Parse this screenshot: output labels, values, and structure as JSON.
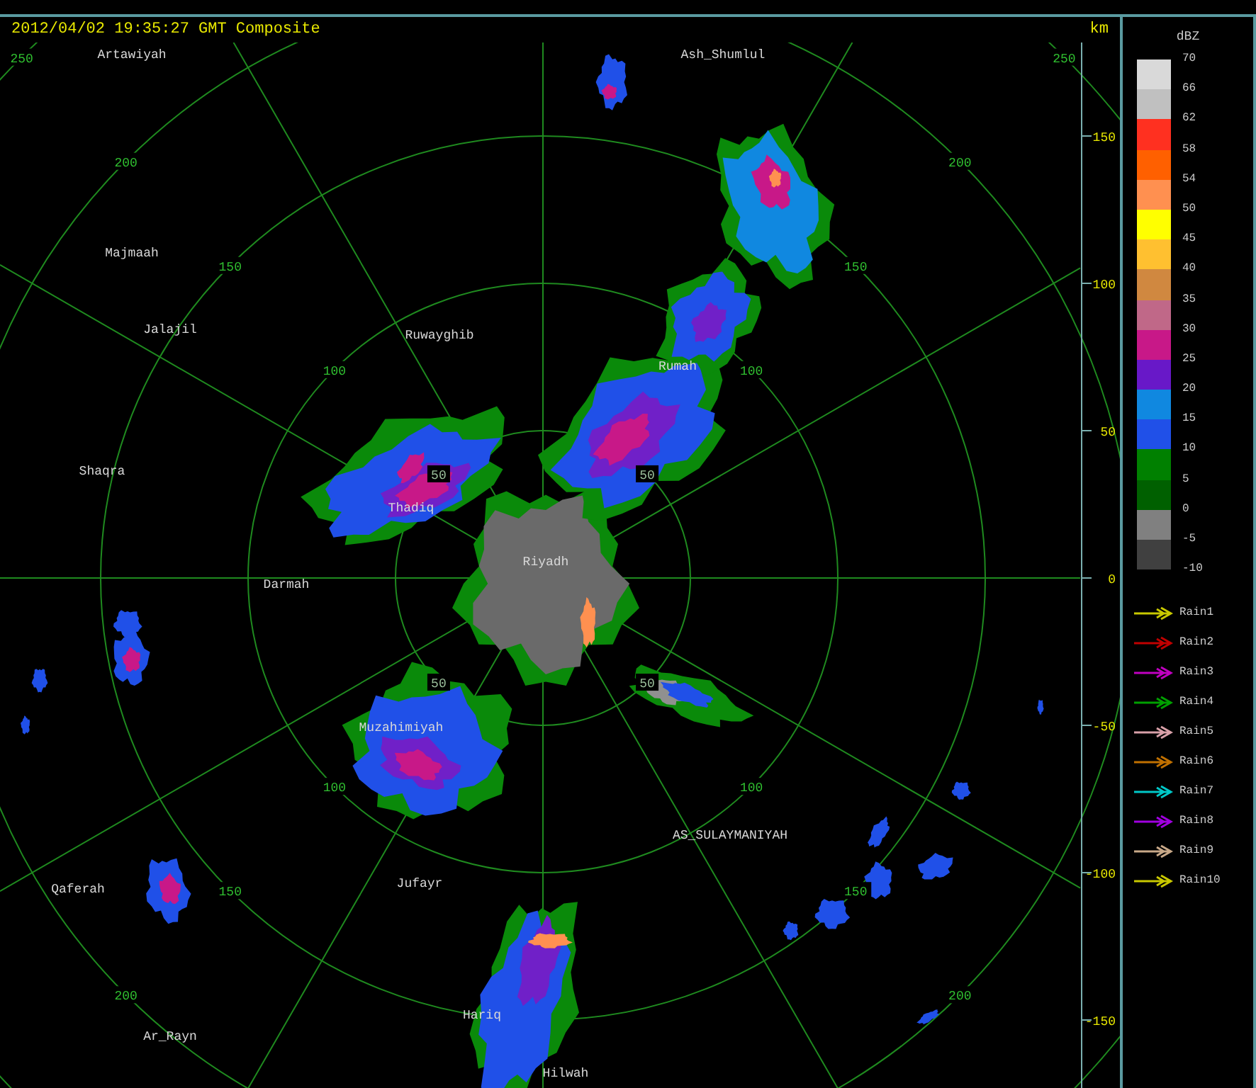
{
  "header": {
    "title": "2012/04/02 19:35:27 GMT Composite",
    "unit": "km"
  },
  "legend": {
    "unit": "dBZ",
    "levels": [
      {
        "label": "70",
        "color": "#d9d9d9"
      },
      {
        "label": "66",
        "color": "#c0c0c0"
      },
      {
        "label": "62",
        "color": "#ff3020"
      },
      {
        "label": "58",
        "color": "#ff6000"
      },
      {
        "label": "54",
        "color": "#ff9050"
      },
      {
        "label": "50",
        "color": "#ffff00"
      },
      {
        "label": "45",
        "color": "#ffc030"
      },
      {
        "label": "40",
        "color": "#d08840"
      },
      {
        "label": "35",
        "color": "#c06888"
      },
      {
        "label": "30",
        "color": "#c81888"
      },
      {
        "label": "25",
        "color": "#6818c8"
      },
      {
        "label": "20",
        "color": "#1088e0"
      },
      {
        "label": "15",
        "color": "#2050e8"
      },
      {
        "label": "10",
        "color": "#008000"
      },
      {
        "label": "5",
        "color": "#006000"
      },
      {
        "label": "0",
        "color": "#808080"
      },
      {
        "label": "-5",
        "color": "#404040"
      },
      {
        "label": "-10"
      }
    ]
  },
  "rain_legend": [
    {
      "label": "Rain1",
      "color": "#c8c800"
    },
    {
      "label": "Rain2",
      "color": "#c00000"
    },
    {
      "label": "Rain3",
      "color": "#c000c0"
    },
    {
      "label": "Rain4",
      "color": "#00a000"
    },
    {
      "label": "Rain5",
      "color": "#d8a0a8"
    },
    {
      "label": "Rain6",
      "color": "#c07000"
    },
    {
      "label": "Rain7",
      "color": "#00c8c8"
    },
    {
      "label": "Rain8",
      "color": "#a000e0"
    },
    {
      "label": "Rain9",
      "color": "#c8a888"
    },
    {
      "label": "Rain10",
      "color": "#c8c800"
    }
  ],
  "km_axis": [
    "150",
    "100",
    "50",
    "0",
    "-50",
    "-100",
    "-150"
  ],
  "ring_labels": {
    "nw": [
      "50",
      "100",
      "150",
      "200",
      "250"
    ],
    "ne": [
      "50",
      "100",
      "150",
      "200",
      "250"
    ],
    "sw": [
      "50",
      "100",
      "150",
      "200"
    ],
    "se": [
      "50",
      "100",
      "150",
      "200"
    ]
  },
  "cities": [
    {
      "name": "Artawiyah"
    },
    {
      "name": "Ash_Shumlul"
    },
    {
      "name": "Majmaah"
    },
    {
      "name": "Jalajil"
    },
    {
      "name": "Ruwayghib"
    },
    {
      "name": "Rumah"
    },
    {
      "name": "Shaqra"
    },
    {
      "name": "Thadiq"
    },
    {
      "name": "Riyadh"
    },
    {
      "name": "Darmah"
    },
    {
      "name": "Muzahimiyah"
    },
    {
      "name": "AS_SULAYMANIYAH"
    },
    {
      "name": "Qaferah"
    },
    {
      "name": "Jufayr"
    },
    {
      "name": "Ar_Rayn"
    },
    {
      "name": "Hariq"
    },
    {
      "name": "Hilwah"
    }
  ]
}
